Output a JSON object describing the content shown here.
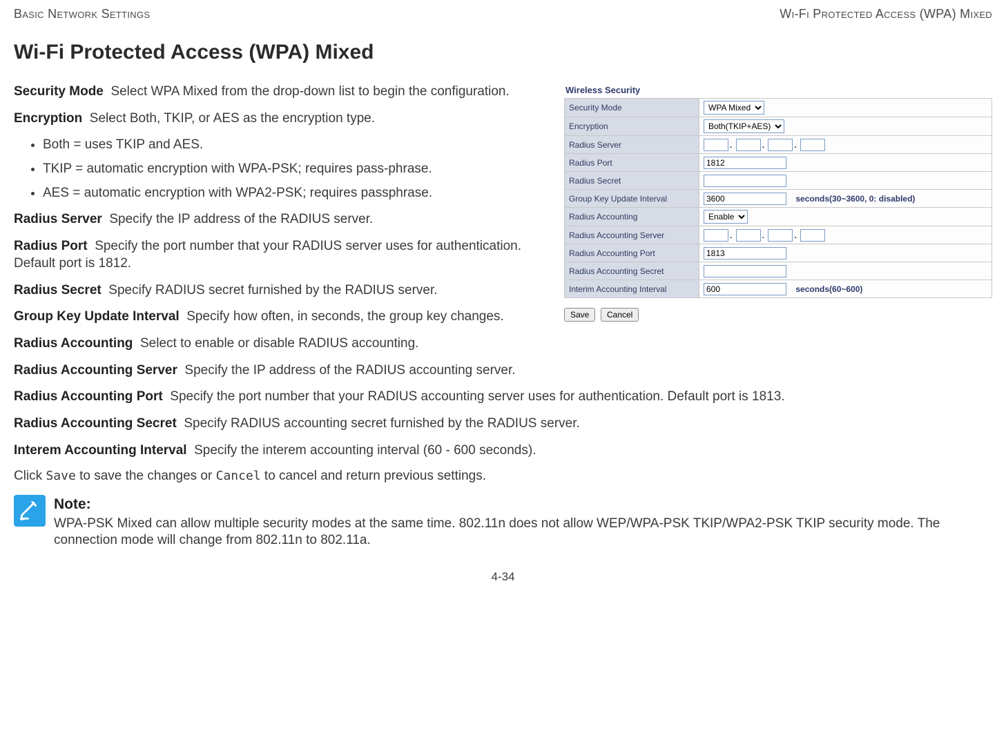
{
  "header": {
    "left": "Basic Network Settings",
    "right": "Wi-Fi Protected Access (WPA) Mixed"
  },
  "title": "Wi-Fi Protected Access (WPA) Mixed",
  "defs": {
    "security_mode": {
      "term": "Security Mode",
      "text": "Select WPA Mixed from the drop-down list to begin the configuration."
    },
    "encryption": {
      "term": "Encryption",
      "text": "Select Both, TKIP, or AES as the encryption type."
    },
    "enc_items": [
      "Both = uses TKIP and AES.",
      "TKIP = automatic encryption with WPA-PSK; requires pass-phrase.",
      "AES = automatic encryption with WPA2-PSK; requires passphrase."
    ],
    "radius_server": {
      "term": "Radius Server",
      "text": "Specify the IP address of the RADIUS server."
    },
    "radius_port": {
      "term": "Radius Port",
      "text": "Specify the port number that your RADIUS server uses for authentication. Default port is 1812."
    },
    "radius_secret": {
      "term": "Radius Secret",
      "text": "Specify RADIUS secret furnished by the RADIUS server."
    },
    "group_key": {
      "term": "Group Key Update Interval",
      "text": "Specify how often, in seconds, the group key changes."
    },
    "radius_acct": {
      "term": "Radius Accounting",
      "text": "Select to enable or disable RADIUS accounting."
    },
    "radius_acct_server": {
      "term": "Radius Accounting Server",
      "text": "Specify the IP address of the RADIUS accounting server."
    },
    "radius_acct_port": {
      "term": "Radius Accounting Port",
      "text": "Specify the port number that your RADIUS accounting server uses for authentication. Default port is 1813."
    },
    "radius_acct_secret": {
      "term": "Radius Accounting Secret",
      "text": "Specify RADIUS accounting secret furnished by the RADIUS server."
    },
    "interem": {
      "term": "Interem Accounting Interval",
      "text": "Specify the interem accounting interval (60 - 600 seconds)."
    }
  },
  "save_line": {
    "prefix": "Click ",
    "save": "Save",
    "mid": " to save the changes or ",
    "cancel": "Cancel",
    "suffix": " to cancel and return previous settings."
  },
  "note": {
    "title": "Note:",
    "body": "WPA-PSK Mixed can allow multiple security modes at the same time. 802.11n does not allow WEP/WPA-PSK TKIP/WPA2-PSK TKIP security mode. The connection mode will change from 802.11n to 802.11a."
  },
  "footer": "4-34",
  "panel": {
    "heading": "Wireless Security",
    "rows": {
      "security_mode": {
        "label": "Security Mode",
        "value": "WPA Mixed"
      },
      "encryption": {
        "label": "Encryption",
        "value": "Both(TKIP+AES)"
      },
      "radius_server": {
        "label": "Radius Server"
      },
      "radius_port": {
        "label": "Radius Port",
        "value": "1812"
      },
      "radius_secret": {
        "label": "Radius Secret"
      },
      "group_key": {
        "label": "Group Key Update Interval",
        "value": "3600",
        "hint": "seconds(30~3600, 0: disabled)"
      },
      "radius_acct": {
        "label": "Radius Accounting",
        "value": "Enable"
      },
      "radius_acct_server": {
        "label": "Radius Accounting Server"
      },
      "radius_acct_port": {
        "label": "Radius Accounting Port",
        "value": "1813"
      },
      "radius_acct_secret": {
        "label": "Radius Accounting Secret"
      },
      "interim": {
        "label": "Interim Accounting Interval",
        "value": "600",
        "hint": "seconds(60~600)"
      }
    },
    "buttons": {
      "save": "Save",
      "cancel": "Cancel"
    }
  }
}
